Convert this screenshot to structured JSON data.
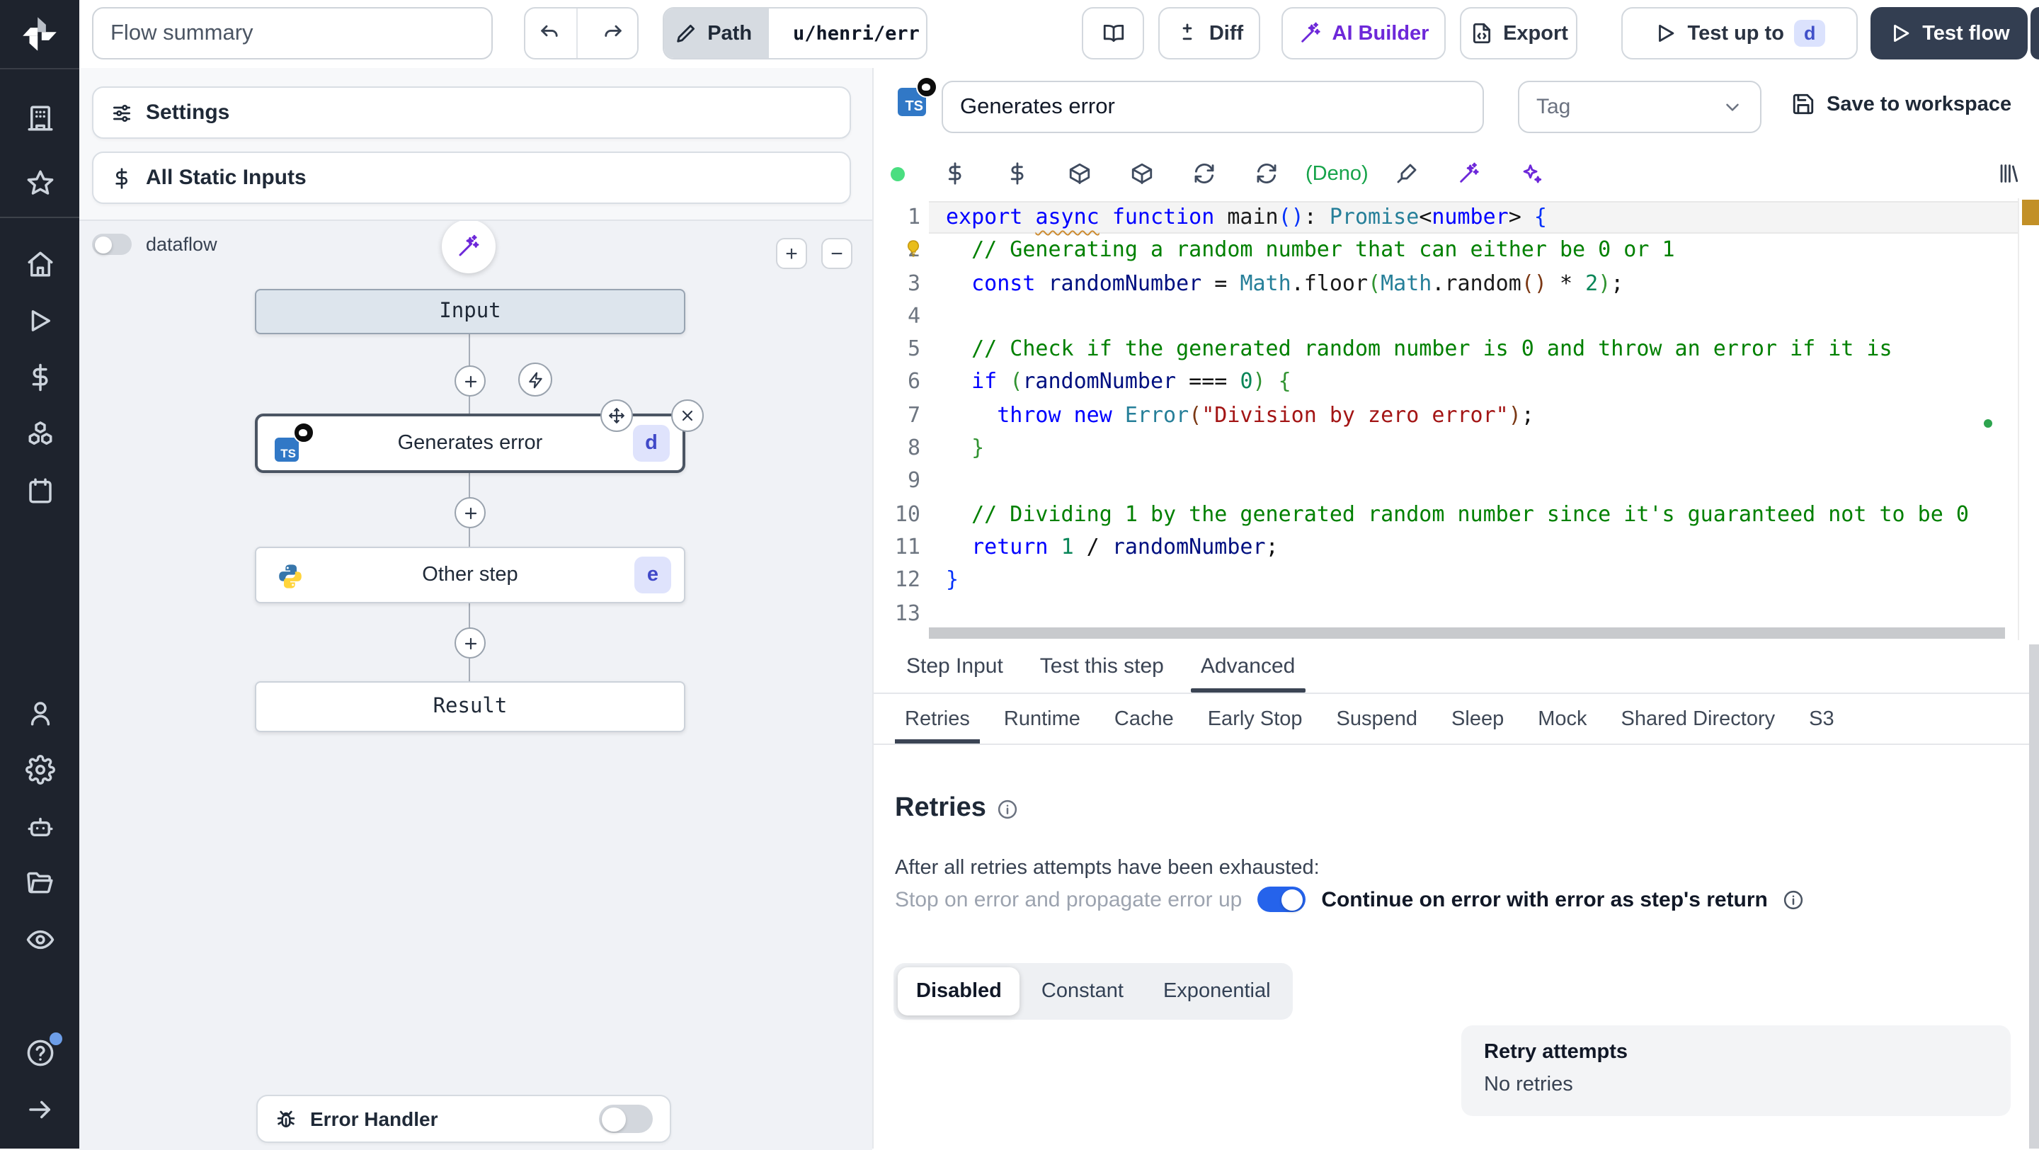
{
  "topbar": {
    "flow_summary": "Flow summary",
    "path_label": "Path",
    "path_value": "u/henri/err",
    "diff_label": "Diff",
    "ai_builder_label": "AI Builder",
    "export_label": "Export",
    "test_up_to_label": "Test up to",
    "test_up_to_badge": "d",
    "test_flow_label": "Test flow"
  },
  "sidebar": {
    "icons": [
      "windmill-logo-icon",
      "building-icon",
      "star-icon",
      "home-icon",
      "play-icon",
      "dollar-icon",
      "boxes-icon",
      "calendar-icon",
      "user-icon",
      "gear-icon",
      "bot-icon",
      "folder-open-icon",
      "eye-icon",
      "help-circle-icon",
      "arrow-right-icon"
    ]
  },
  "flow_panel": {
    "settings_label": "Settings",
    "all_static_inputs_label": "All Static Inputs",
    "dataflow_label": "dataflow",
    "zoom_in": "+",
    "zoom_out": "−",
    "input_node_label": "Input",
    "step1_title": "Generates error",
    "step1_badge": "d",
    "step1_lang_badge": "TS",
    "step2_title": "Other step",
    "step2_badge": "e",
    "result_node_label": "Result",
    "error_handler_label": "Error Handler"
  },
  "editor": {
    "step_name": "Generates error",
    "tag_placeholder": "Tag",
    "save_label": "Save to workspace",
    "lang_badge": "TS",
    "deno_label": "(Deno)",
    "tabs": [
      "Step Input",
      "Test this step",
      "Advanced"
    ],
    "active_tab": "Advanced",
    "subtabs": [
      "Retries",
      "Runtime",
      "Cache",
      "Early Stop",
      "Suspend",
      "Sleep",
      "Mock",
      "Shared Directory",
      "S3"
    ],
    "active_subtab": "Retries"
  },
  "retries": {
    "heading": "Retries",
    "exhausted_label": "After all retries attempts have been exhausted:",
    "stop_option": "Stop on error and propagate error up",
    "continue_option": "Continue on error with error as step's return",
    "modes": [
      "Disabled",
      "Constant",
      "Exponential"
    ],
    "active_mode": "Disabled",
    "retry_attempts_label": "Retry attempts",
    "retry_attempts_value": "No retries"
  },
  "code": {
    "language": "typescript",
    "lines": [
      [
        [
          "kw",
          "export"
        ],
        [
          "pl",
          " "
        ],
        [
          "kwsq",
          "async"
        ],
        [
          "pl",
          " "
        ],
        [
          "kw",
          "function"
        ],
        [
          "pl",
          " "
        ],
        [
          "fn",
          "main"
        ],
        [
          "b1",
          "()"
        ],
        [
          "pl",
          ": "
        ],
        [
          "ty",
          "Promise"
        ],
        [
          "pl",
          "<"
        ],
        [
          "kw",
          "number"
        ],
        [
          "pl",
          "> "
        ],
        [
          "b1",
          "{"
        ]
      ],
      [
        [
          "pl",
          "  "
        ],
        [
          "cm",
          "// Generating a random number that can either be 0 or 1"
        ]
      ],
      [
        [
          "pl",
          "  "
        ],
        [
          "kw",
          "const"
        ],
        [
          "pl",
          " "
        ],
        [
          "vr",
          "randomNumber"
        ],
        [
          "pl",
          " = "
        ],
        [
          "ty",
          "Math"
        ],
        [
          "pl",
          "."
        ],
        [
          "fn",
          "floor"
        ],
        [
          "b2",
          "("
        ],
        [
          "ty",
          "Math"
        ],
        [
          "pl",
          "."
        ],
        [
          "fn",
          "random"
        ],
        [
          "b3",
          "()"
        ],
        [
          "pl",
          " * "
        ],
        [
          "nu",
          "2"
        ],
        [
          "b2",
          ")"
        ],
        [
          "pl",
          ";"
        ]
      ],
      [],
      [
        [
          "pl",
          "  "
        ],
        [
          "cm",
          "// Check if the generated random number is 0 and throw an error if it is"
        ]
      ],
      [
        [
          "pl",
          "  "
        ],
        [
          "kw",
          "if"
        ],
        [
          "pl",
          " "
        ],
        [
          "b2",
          "("
        ],
        [
          "vr",
          "randomNumber"
        ],
        [
          "pl",
          " === "
        ],
        [
          "nu",
          "0"
        ],
        [
          "b2",
          ")"
        ],
        [
          "pl",
          " "
        ],
        [
          "b2",
          "{"
        ]
      ],
      [
        [
          "pl",
          "    "
        ],
        [
          "kw",
          "throw"
        ],
        [
          "pl",
          " "
        ],
        [
          "kw",
          "new"
        ],
        [
          "pl",
          " "
        ],
        [
          "ty",
          "Error"
        ],
        [
          "b3",
          "("
        ],
        [
          "st",
          "\"Division by zero error\""
        ],
        [
          "b3",
          ")"
        ],
        [
          "pl",
          ";"
        ]
      ],
      [
        [
          "pl",
          "  "
        ],
        [
          "b2",
          "}"
        ]
      ],
      [],
      [
        [
          "pl",
          "  "
        ],
        [
          "cm",
          "// Dividing 1 by the generated random number since it's guaranteed not to be 0"
        ]
      ],
      [
        [
          "pl",
          "  "
        ],
        [
          "kw",
          "return"
        ],
        [
          "pl",
          " "
        ],
        [
          "nu",
          "1"
        ],
        [
          "pl",
          " / "
        ],
        [
          "vr",
          "randomNumber"
        ],
        [
          "pl",
          ";"
        ]
      ],
      [
        [
          "b1",
          "}"
        ]
      ],
      []
    ]
  },
  "colors": {
    "sidebar_bg": "#1e232d",
    "accent_purple": "#6d28d9",
    "toggle_blue": "#2563eb",
    "deno_green": "#16a34a",
    "warning_amber": "#c29027",
    "badge_indigo_bg": "#dbe2fd",
    "badge_indigo_text": "#4050c9",
    "dark_button": "#333e51",
    "ts_blue": "#3178c6"
  }
}
